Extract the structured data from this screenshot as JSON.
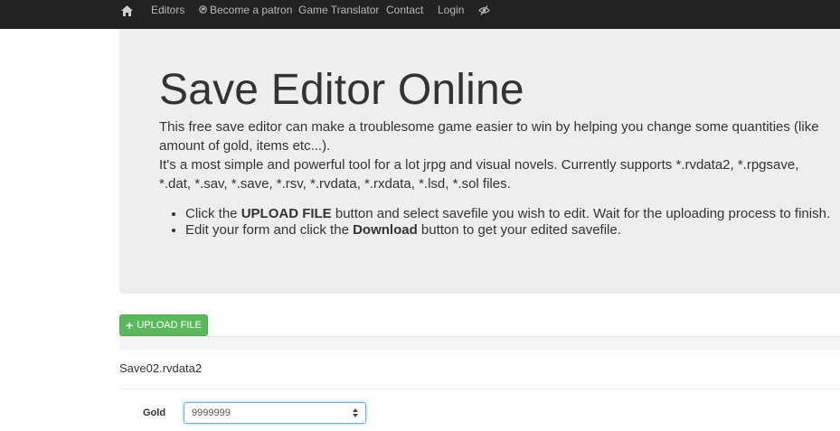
{
  "nav": {
    "home_icon": "home-icon",
    "links": [
      {
        "label": "Editors"
      },
      {
        "label": "Become a patron",
        "icon": "patreon-icon"
      },
      {
        "label": "Game Translator"
      },
      {
        "label": "Contact"
      },
      {
        "label": "Login"
      }
    ],
    "eye_icon": "eye-slash-icon"
  },
  "hero": {
    "title": "Save Editor Online",
    "intro_line1": "This free save editor can make a troublesome game easier to win by helping you change some quantities (like amount of gold, items etc...).",
    "intro_line2": "It's a most simple and powerful tool for a lot jrpg and visual novels. Currently supports *.rvdata2, *.rpgsave, *.dat, *.sav, *.save, *.rsv, *.rvdata, *.rxdata, *.lsd, *.sol files.",
    "steps": [
      {
        "before": "Click the ",
        "bold": "UPLOAD FILE",
        "after": " button and select savefile you wish to edit. Wait for the uploading process to finish."
      },
      {
        "before": "Edit your form and click the ",
        "bold": "Download",
        "after": " button to get your edited savefile."
      }
    ]
  },
  "upload": {
    "label": "UPLOAD FILE",
    "icon": "plus-icon"
  },
  "file": {
    "name": "Save02.rvdata2"
  },
  "fields": [
    {
      "label": "Gold",
      "value": "9999999"
    }
  ],
  "colors": {
    "navbar": "#222222",
    "jumbotron": "#eeeeee",
    "upload_button": "#5cb85c",
    "focus_border": "#66afe9"
  }
}
